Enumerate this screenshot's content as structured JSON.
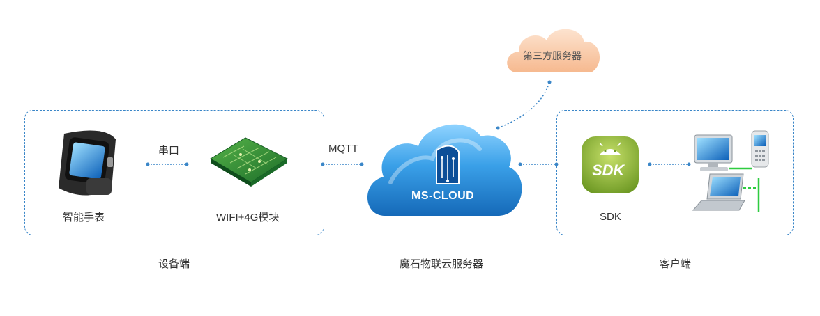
{
  "device_side": {
    "caption": "设备端",
    "watch_label": "智能手表",
    "serial_label": "串口",
    "module_label": "WIFI+4G模块"
  },
  "protocol_label": "MQTT",
  "cloud": {
    "name": "MS-CLOUD",
    "caption": "魔石物联云服务器"
  },
  "third_party": {
    "label": "第三方服务器"
  },
  "client_side": {
    "caption": "客户端",
    "sdk_badge": "SDK",
    "sdk_label": "SDK"
  },
  "colors": {
    "dashed_line": "#3a86c8",
    "cloud_blue": "#2f8fd6",
    "third_party_cloud": "#f8c9a8",
    "sdk_green": "#8fb43a",
    "pcb_green": "#2f8f3a",
    "network_green": "#2ecc40"
  }
}
